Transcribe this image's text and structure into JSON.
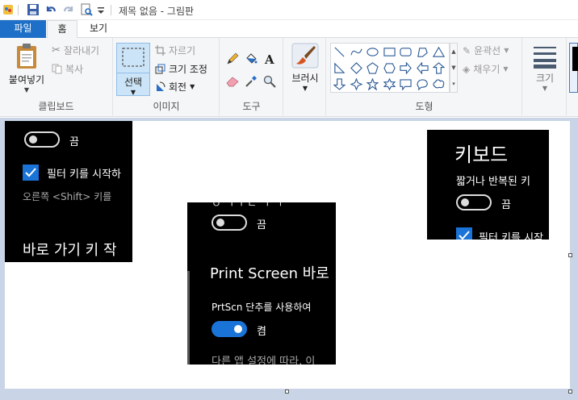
{
  "window": {
    "title": "제목 없음 - 그림판"
  },
  "tabs": {
    "file": "파일",
    "home": "홈",
    "view": "보기"
  },
  "clipboard": {
    "paste": "붙여넣기",
    "cut": "잘라내기",
    "copy": "복사",
    "label": "클립보드"
  },
  "image": {
    "select": "선택",
    "crop": "자르기",
    "resize": "크기 조정",
    "rotate": "회전",
    "label": "이미지"
  },
  "tools": {
    "label": "도구"
  },
  "brushes": {
    "label": "브러시"
  },
  "shapes": {
    "outline": "윤곽선",
    "fill": "채우기",
    "label": "도형"
  },
  "size": {
    "label": "크기"
  },
  "shot1": {
    "toggle_state": "끔",
    "checkbox_label": "필터 키를 시작하",
    "hint": "오른쪽 <Shift> 키를",
    "heading": "바로 가기 키 작"
  },
  "shot2": {
    "top_cut": "ㅇ ㄱㄱ ㄴ ㄱ ㄱ",
    "toggle_state": "끔",
    "heading": "Print Screen 바로",
    "desc": "PrtScn 단추를 사용하여",
    "toggle2_state": "켬",
    "footer": "다른 앱 설정에 따라, 이"
  },
  "shot3": {
    "heading": "키보드",
    "sub": "짧거나 반복된 키",
    "toggle_state": "끔",
    "checkbox_label": "필터 키를 시작"
  }
}
